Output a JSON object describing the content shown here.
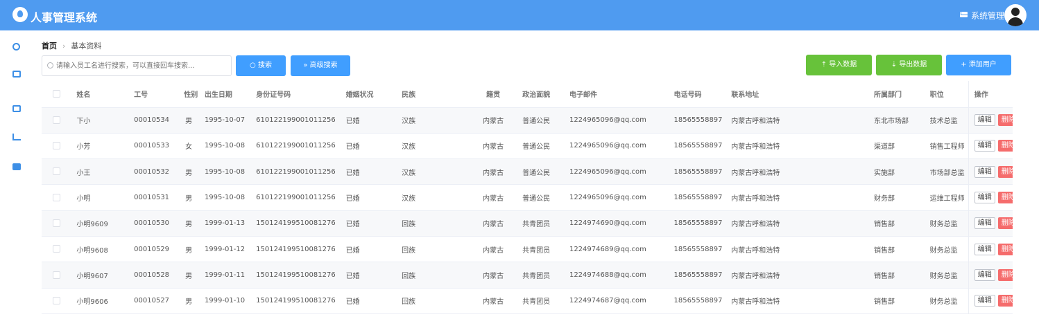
{
  "header": {
    "app_title": "人事管理系统",
    "user_name": "系统管理员"
  },
  "sidebar": {
    "icons": [
      "user-icon",
      "id-card-icon",
      "camera-icon",
      "chart-icon",
      "windows-icon"
    ]
  },
  "breadcrumb": {
    "home": "首页",
    "current": "基本资料"
  },
  "toolbar": {
    "search_placeholder": "请输入员工名进行搜索，可以直接回车搜索...",
    "search_label": "搜索",
    "advanced_label": "高级搜索",
    "import_label": "导入数据",
    "export_label": "导出数据",
    "add_label": "添加用户"
  },
  "colors": {
    "header": "#4f9bf0",
    "primary": "#409eff",
    "success": "#67c23a",
    "danger": "#f56c6c"
  },
  "table": {
    "headers": [
      "姓名",
      "工号",
      "性别",
      "出生日期",
      "身份证号码",
      "婚姻状况",
      "民族",
      "籍贯",
      "政治面貌",
      "电子邮件",
      "电话号码",
      "联系地址",
      "所属部门",
      "职位",
      "操作"
    ],
    "edit_label": "编辑",
    "delete_label": "删除",
    "rows": [
      {
        "name": "下小",
        "id": "00010534",
        "gender": "男",
        "birth": "1995-10-07",
        "idcard": "610122199001011256",
        "marital": "已婚",
        "nation": "汉族",
        "native": "内蒙古",
        "politic": "普通公民",
        "email": "1224965096@qq.com",
        "phone": "18565558897",
        "address": "内蒙古呼和浩特",
        "dept": "东北市场部",
        "position": "技术总监"
      },
      {
        "name": "小芳",
        "id": "00010533",
        "gender": "女",
        "birth": "1995-10-08",
        "idcard": "610122199001011256",
        "marital": "已婚",
        "nation": "汉族",
        "native": "内蒙古",
        "politic": "普通公民",
        "email": "1224965096@qq.com",
        "phone": "18565558897",
        "address": "内蒙古呼和浩特",
        "dept": "渠道部",
        "position": "销售工程师"
      },
      {
        "name": "小王",
        "id": "00010532",
        "gender": "男",
        "birth": "1995-10-08",
        "idcard": "610122199001011256",
        "marital": "已婚",
        "nation": "汉族",
        "native": "内蒙古",
        "politic": "普通公民",
        "email": "1224965096@qq.com",
        "phone": "18565558897",
        "address": "内蒙古呼和浩特",
        "dept": "实施部",
        "position": "市场部总监"
      },
      {
        "name": "小明",
        "id": "00010531",
        "gender": "男",
        "birth": "1995-10-08",
        "idcard": "610122199001011256",
        "marital": "已婚",
        "nation": "汉族",
        "native": "内蒙古",
        "politic": "普通公民",
        "email": "1224965096@qq.com",
        "phone": "18565558897",
        "address": "内蒙古呼和浩特",
        "dept": "财务部",
        "position": "运维工程师"
      },
      {
        "name": "小明9609",
        "id": "00010530",
        "gender": "男",
        "birth": "1999-01-13",
        "idcard": "150124199510081276",
        "marital": "已婚",
        "nation": "回族",
        "native": "内蒙古",
        "politic": "共青团员",
        "email": "1224974690@qq.com",
        "phone": "18565558897",
        "address": "内蒙古呼和浩特",
        "dept": "销售部",
        "position": "财务总监"
      },
      {
        "name": "小明9608",
        "id": "00010529",
        "gender": "男",
        "birth": "1999-01-12",
        "idcard": "150124199510081276",
        "marital": "已婚",
        "nation": "回族",
        "native": "内蒙古",
        "politic": "共青团员",
        "email": "1224974689@qq.com",
        "phone": "18565558897",
        "address": "内蒙古呼和浩特",
        "dept": "销售部",
        "position": "财务总监"
      },
      {
        "name": "小明9607",
        "id": "00010528",
        "gender": "男",
        "birth": "1999-01-11",
        "idcard": "150124199510081276",
        "marital": "已婚",
        "nation": "回族",
        "native": "内蒙古",
        "politic": "共青团员",
        "email": "1224974688@qq.com",
        "phone": "18565558897",
        "address": "内蒙古呼和浩特",
        "dept": "销售部",
        "position": "财务总监"
      },
      {
        "name": "小明9606",
        "id": "00010527",
        "gender": "男",
        "birth": "1999-01-10",
        "idcard": "150124199510081276",
        "marital": "已婚",
        "nation": "回族",
        "native": "内蒙古",
        "politic": "共青团员",
        "email": "1224974687@qq.com",
        "phone": "18565558897",
        "address": "内蒙古呼和浩特",
        "dept": "销售部",
        "position": "财务总监"
      }
    ]
  }
}
